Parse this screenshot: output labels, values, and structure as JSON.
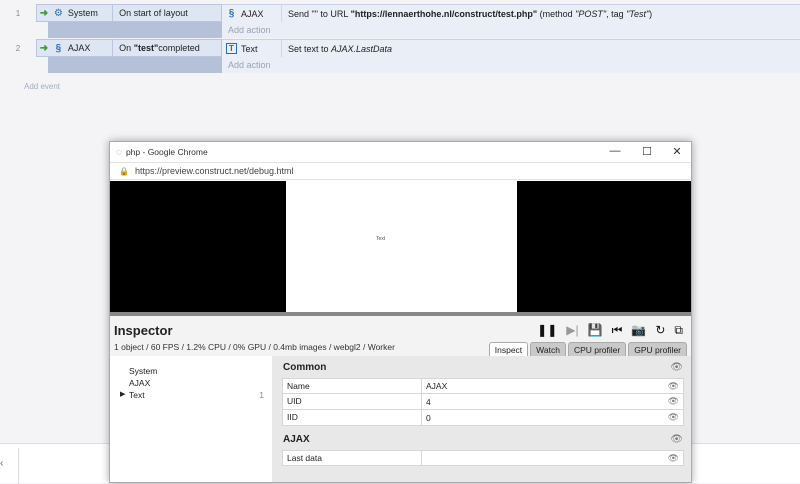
{
  "events": [
    {
      "number": "1",
      "condition": {
        "object": "System",
        "text": "On start of layout",
        "icon": "gear-icon"
      },
      "action": {
        "object": "AJAX",
        "icon": "ajax-icon",
        "text_pre": "Send \"\" to URL ",
        "url": "\"https://lennaerthohe.nl/construct/test.php\"",
        "text_mid": " (method ",
        "method": "\"POST\"",
        "text_tag": ", tag ",
        "tag": "\"Test\"",
        "text_end": ")"
      },
      "add_action": "Add action"
    },
    {
      "number": "2",
      "condition": {
        "object": "AJAX",
        "text_pre": "On ",
        "tag": "\"test\"",
        "text_post": " completed",
        "icon": "ajax-icon"
      },
      "action": {
        "object": "Text",
        "icon": "text-object-icon",
        "text_pre": "Set text to ",
        "expr": "AJAX.LastData"
      },
      "add_action": "Add action"
    }
  ],
  "add_event": "Add event",
  "browser": {
    "title": "php - Google Chrome",
    "url": "https://preview.construct.net/debug.html",
    "canvas_text": "Text"
  },
  "inspector": {
    "title": "Inspector",
    "stats": "1 object / 60 FPS / 1.2% CPU / 0% GPU / 0.4mb images / webgl2 / Worker",
    "tabs": [
      "Inspect",
      "Watch",
      "CPU profiler",
      "GPU profiler"
    ],
    "tree": [
      {
        "label": "System",
        "count": ""
      },
      {
        "label": "AJAX",
        "count": ""
      },
      {
        "label": "Text",
        "count": "1",
        "expanded": true
      }
    ],
    "sections": [
      {
        "title": "Common",
        "rows": [
          {
            "key": "Name",
            "value": "AJAX"
          },
          {
            "key": "UID",
            "value": "4"
          },
          {
            "key": "IID",
            "value": "0"
          }
        ]
      },
      {
        "title": "AJAX",
        "rows": [
          {
            "key": "Last data",
            "value": ""
          }
        ]
      }
    ]
  },
  "colors": {
    "accent": "#3a9b3a",
    "event_bg": "#dfe6f3"
  }
}
